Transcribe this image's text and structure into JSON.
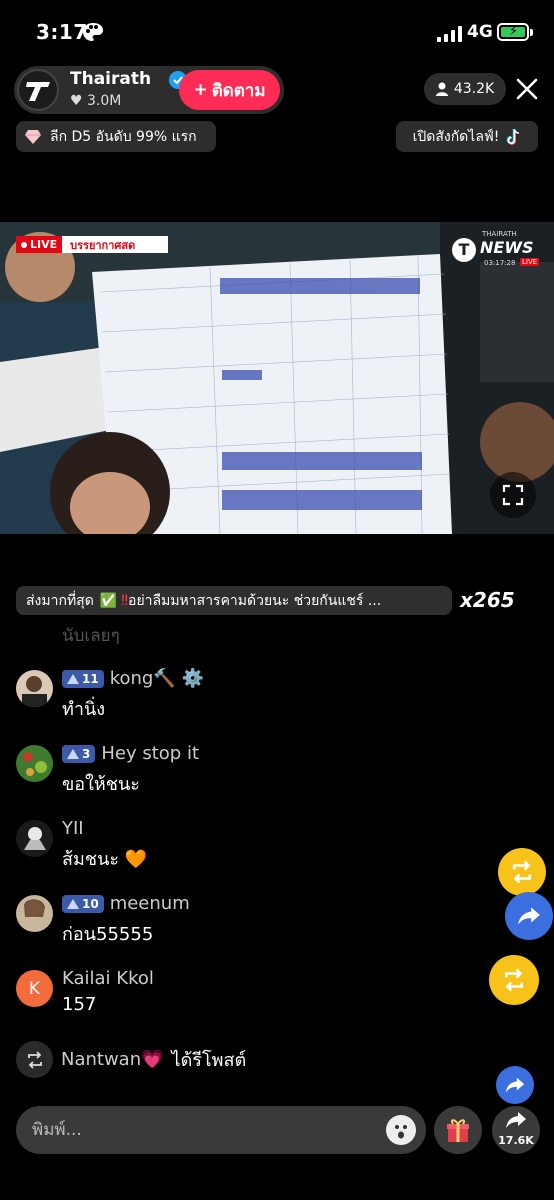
{
  "status_bar": {
    "time": "3:17",
    "network": "4G"
  },
  "host": {
    "name": "Thairath",
    "likes": "3.0M",
    "follow_label": "ติดตาม"
  },
  "viewers": "43.2K",
  "rank_text": "ลีก D5 อันดับ 99% แรก",
  "subscribe_text": "เปิดสังกัดไลฟ์!",
  "video": {
    "live_label": "LIVE",
    "caption": "บรรยากาศสด",
    "news_top": "THAIRATH",
    "news_main": "NEWS",
    "news_time": "03:17:28",
    "news_live": "LIVE"
  },
  "pinned": {
    "label": "ส่งมากที่สุด",
    "text": "อย่าลืมมหาสารคามด้วยนะ ช่วยกันแชร์ ...",
    "count": "x265"
  },
  "faded_text": "นับเลยๆ",
  "comments": [
    {
      "level": "11",
      "user": "kong🔨 ⚙️",
      "text": "ทำนิ่ง",
      "avatar_color": "#d9c9b6"
    },
    {
      "level": "3",
      "user": "Hey stop it",
      "text": "ขอให้ชนะ",
      "avatar_color": "#3f7a2e"
    },
    {
      "level": "",
      "user": "YII",
      "text": "ส้มชนะ 🧡",
      "avatar_color": "#1a1a1a"
    },
    {
      "level": "10",
      "user": "meenum",
      "text": "ก่อน55555",
      "avatar_color": "#c8b79d"
    },
    {
      "level": "",
      "user": "Kailai Kkol",
      "text": "157",
      "avatar_color": "#f26b3a",
      "initial": "K"
    }
  ],
  "repost": {
    "user": "Nantwan💗",
    "action": "ได้รีโพสต์"
  },
  "input": {
    "placeholder": "พิมพ์..."
  },
  "share_count": "17.6K",
  "colors": {
    "follow": "#fe2c55",
    "repost_fab": "#f7c21a",
    "share_fab": "#3b6fe0",
    "badge": "#3d5aa8"
  }
}
